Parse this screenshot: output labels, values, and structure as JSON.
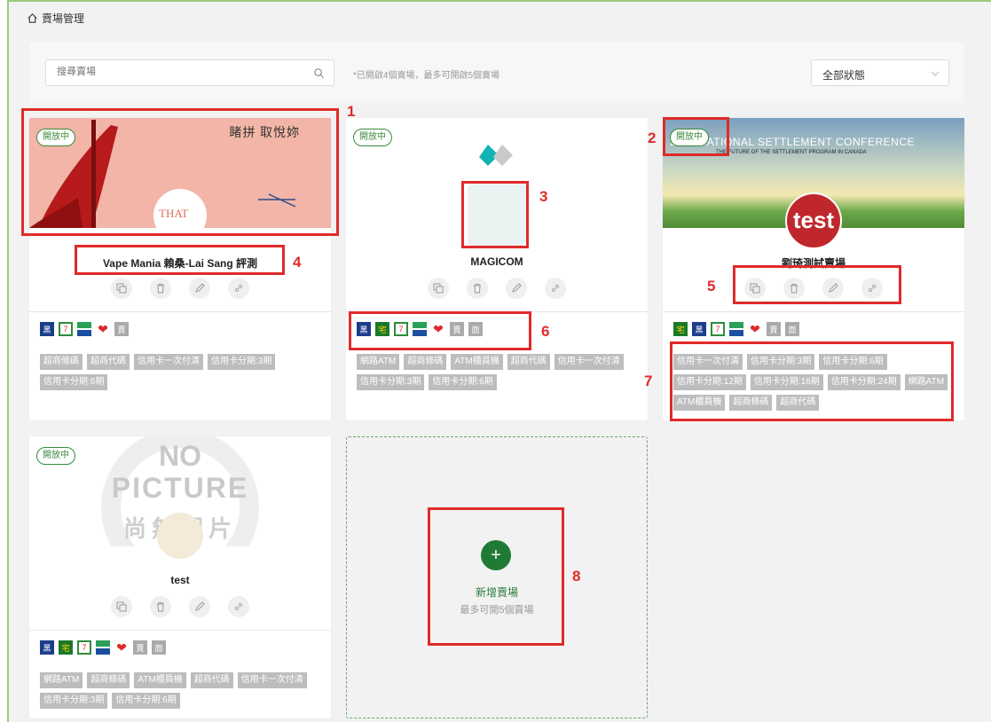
{
  "breadcrumb": {
    "title": "賣場管理"
  },
  "toolbar": {
    "search_placeholder": "搜尋賣場",
    "hint": "*已開啟4個賣場，最多可開啟5個賣場",
    "status_select": "全部狀態"
  },
  "stores": [
    {
      "status": "開放中",
      "name": "Vape Mania 賴桑-Lai Sang 評測",
      "banner_text": "睹拼 取悅妳",
      "banner_logo_text": "THAT",
      "payments": [
        "黑貓",
        "7-11",
        "全家",
        "萊爾富",
        "賣"
      ],
      "tags": [
        "超商條碼",
        "超商代碼",
        "信用卡一次付清",
        "信用卡分期:3期",
        "信用卡分期:6期"
      ]
    },
    {
      "status": "開放中",
      "name": "MAGICOM",
      "payments": [
        "黑貓",
        "宅配通",
        "7-11",
        "全家",
        "萊爾富",
        "賣",
        "面"
      ],
      "tags": [
        "網路ATM",
        "超商條碼",
        "ATM櫃員機",
        "超商代碼",
        "信用卡一次付清",
        "信用卡分期:3期",
        "信用卡分期:6期"
      ]
    },
    {
      "status": "開放中",
      "name": "劉琦測試賣場",
      "banner_text": "2020 NATIONAL SETTLEMENT CONFERENCE",
      "banner_sub": "THE FUTURE OF THE SETTLEMENT PROGRAM IN CANADA",
      "logo_text": "test",
      "payments": [
        "宅配通",
        "黑貓",
        "7-11",
        "全家",
        "萊爾富",
        "賣",
        "面"
      ],
      "tags": [
        "信用卡一次付清",
        "信用卡分期:3期",
        "信用卡分期:6期",
        "信用卡分期:12期",
        "信用卡分期:18期",
        "信用卡分期:24期",
        "網路ATM",
        "ATM櫃員機",
        "超商條碼",
        "超商代碼"
      ]
    },
    {
      "status": "開放中",
      "name": "test",
      "banner_text_1": "NO",
      "banner_text_2": "PICTURE",
      "banner_text_3": "尚無圖片",
      "payments": [
        "黑貓",
        "宅配通",
        "7-11",
        "全家",
        "萊爾富",
        "賣",
        "面"
      ],
      "tags": [
        "網路ATM",
        "超商條碼",
        "ATM櫃員機",
        "超商代碼",
        "信用卡一次付清",
        "信用卡分期:3期",
        "信用卡分期:6期"
      ]
    }
  ],
  "add_store": {
    "title": "新增賣場",
    "subtitle": "最多可開5個賣場"
  },
  "annotations": [
    "1",
    "2",
    "3",
    "4",
    "5",
    "6",
    "7",
    "8"
  ],
  "colors": {
    "accent": "#1f7a35",
    "annotation": "#e02a2a",
    "tag_bg": "#bdbdbd"
  }
}
